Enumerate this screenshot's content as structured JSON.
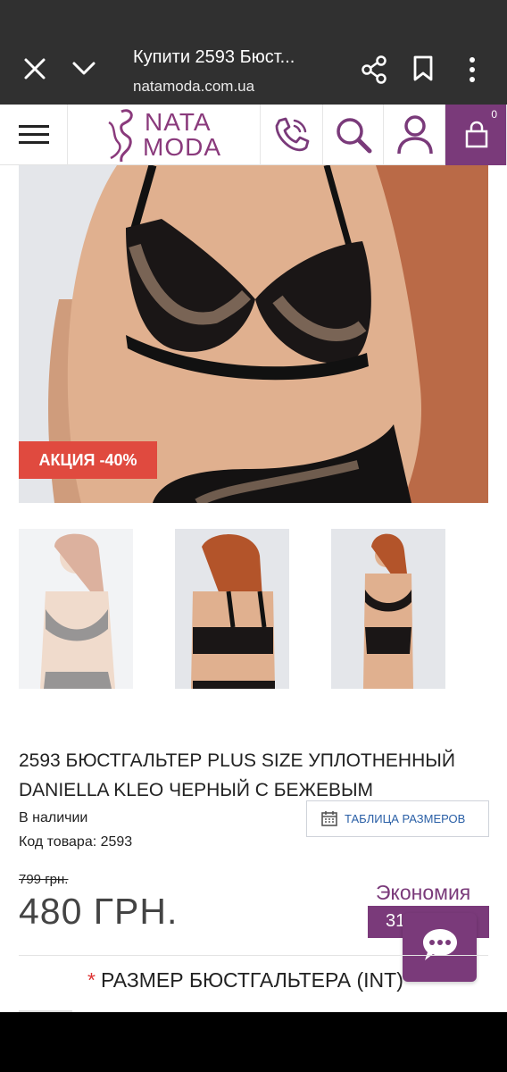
{
  "tab": {
    "title": "Купити 2593 Бюст...",
    "url": "natamoda.com.ua"
  },
  "header": {
    "logo_line1": "NATA",
    "logo_line2": "MODA",
    "cart_count": "0"
  },
  "product": {
    "sale_badge": "АКЦИЯ -40%",
    "title": "2593 БЮСТГАЛЬТЕР PLUS SIZE УПЛОТНЕННЫЙ DANIELLA KLEO ЧЕРНЫЙ С БЕЖЕВЫМ",
    "stock": "В наличии",
    "sku": "Код товара: 2593",
    "size_table_label": "ТАБЛИЦА РАЗМЕРОВ",
    "old_price": "799 грн.",
    "new_price": "480 ГРН.",
    "economy_label": "Экономия",
    "economy_value": "31",
    "size_required_mark": "*",
    "size_heading": "РАЗМЕР БЮСТГАЛЬТЕРА (INT)"
  },
  "colors": {
    "accent": "#7a3a7a",
    "sale": "#e04a3f",
    "link": "#2a5fa6"
  }
}
